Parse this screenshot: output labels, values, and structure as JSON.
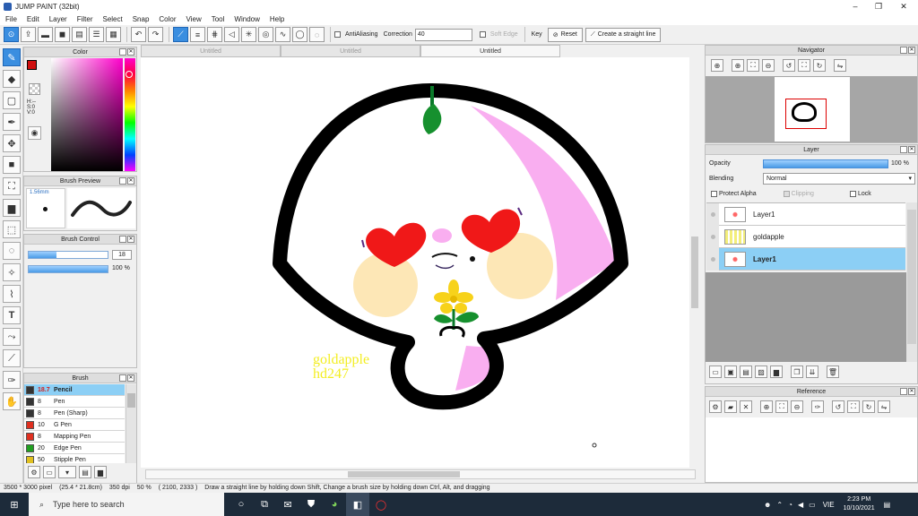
{
  "window": {
    "title": "JUMP PAINT (32bit)",
    "minimize": "–",
    "maximize": "❐",
    "close": "✕"
  },
  "menu": [
    "File",
    "Edit",
    "Layer",
    "Filter",
    "Select",
    "Snap",
    "Color",
    "View",
    "Tool",
    "Window",
    "Help"
  ],
  "toolbar": {
    "antialiasing_label": "AntiAliasing",
    "correction_label": "Correction",
    "correction_value": "40",
    "soft_edge_label": "Soft Edge",
    "key_label": "Key",
    "reset_label": "Reset",
    "straight_line_label": "Create a straight line"
  },
  "tabs": [
    "Untitled",
    "Untitled",
    "Untitled"
  ],
  "color_panel": {
    "title": "Color",
    "h": "H:--",
    "s": "S:0",
    "v": "V:0"
  },
  "brush_preview": {
    "title": "Brush Preview",
    "size": "1.56mm"
  },
  "brush_control": {
    "title": "Brush Control",
    "size_value": "18",
    "opacity_value": "100 %"
  },
  "brush_panel": {
    "title": "Brush",
    "items": [
      {
        "size": "18.7",
        "name": "Pencil",
        "color": "#333333"
      },
      {
        "size": "8",
        "name": "Pen",
        "color": "#333333"
      },
      {
        "size": "8",
        "name": "Pen (Sharp)",
        "color": "#333333"
      },
      {
        "size": "10",
        "name": "G Pen",
        "color": "#e03020"
      },
      {
        "size": "8",
        "name": "Mapping Pen",
        "color": "#e03020"
      },
      {
        "size": "20",
        "name": "Edge Pen",
        "color": "#20a020"
      },
      {
        "size": "50",
        "name": "Stipple Pen",
        "color": "#e0c020"
      }
    ]
  },
  "navigator": {
    "title": "Navigator"
  },
  "layer_panel": {
    "title": "Layer",
    "opacity_label": "Opacity",
    "opacity_value": "100 %",
    "opacity_fraction": 1.0,
    "blending_label": "Blending",
    "blending_value": "Normal",
    "protect_alpha_label": "Protect Alpha",
    "clipping_label": "Clipping",
    "lock_label": "Lock",
    "layers": [
      {
        "name": "Layer1",
        "selected": false
      },
      {
        "name": "goldapple",
        "selected": false
      },
      {
        "name": "Layer1",
        "selected": true
      }
    ]
  },
  "reference": {
    "title": "Reference"
  },
  "artwork": {
    "watermark_line1": "goldapple",
    "watermark_line2": "hd247"
  },
  "status": {
    "size": "3500 * 3000 pixel",
    "physical": "(25.4 * 21.8cm)",
    "dpi": "350 dpi",
    "zoom": "50 %",
    "coords": "( 2100, 2333 )",
    "hint": "Draw a straight line by holding down Shift, Change a brush size by holding down Ctrl, Alt, and dragging"
  },
  "taskbar": {
    "search_placeholder": "Type here to search",
    "time": "2:23 PM",
    "date": "10/10/2021",
    "lang": "VIE"
  }
}
